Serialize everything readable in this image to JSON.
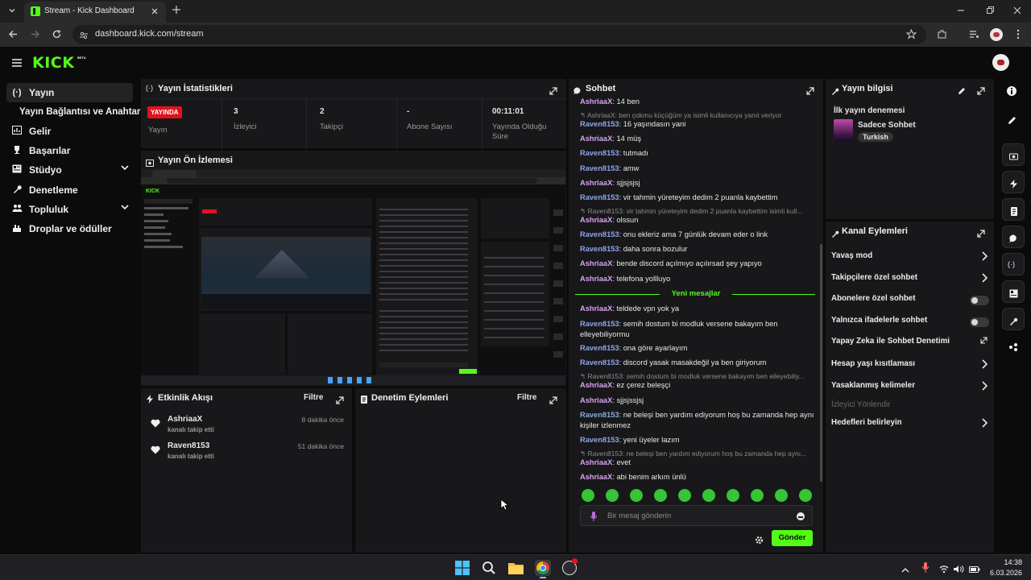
{
  "browser": {
    "tab_title": "Stream - Kick Dashboard",
    "url": "dashboard.kick.com/stream"
  },
  "header": {
    "logo": "KICK",
    "logo_badge": "BETA"
  },
  "sidebar": {
    "items": [
      {
        "label": "Yayın",
        "icon": "broadcast-icon"
      },
      {
        "label": "Yayın Bağlantısı ve Anahtarı"
      },
      {
        "label": "Gelir",
        "icon": "revenue-icon"
      },
      {
        "label": "Başarılar",
        "icon": "trophy-icon"
      },
      {
        "label": "Stüdyo",
        "icon": "studio-icon"
      },
      {
        "label": "Denetleme",
        "icon": "wrench-icon"
      },
      {
        "label": "Topluluk",
        "icon": "community-icon"
      },
      {
        "label": "Droplar ve ödüller",
        "icon": "drops-icon"
      }
    ]
  },
  "stats": {
    "title": "Yayın İstatistikleri",
    "live_badge": "YAYINDA",
    "live_label": "Yayın",
    "viewers_value": "3",
    "viewers_label": "İzleyici",
    "followers_value": "2",
    "followers_label": "Takipçi",
    "subs_value": "-",
    "subs_label": "Abone Sayısı",
    "uptime_value": "00:11:01",
    "uptime_label": "Yayında Olduğu Süre"
  },
  "preview": {
    "title": "Yayın Ön İzlemesi"
  },
  "activity": {
    "title": "Etkinlik Akışı",
    "filter": "Filtre",
    "items": [
      {
        "user": "AshriaaX",
        "time": "8 dakika önce",
        "action": "kanalı takip etti"
      },
      {
        "user": "Raven8153",
        "time": "51 dakika önce",
        "action": "kanalı takip etti"
      }
    ]
  },
  "moderation": {
    "title": "Denetim Eylemleri",
    "filter": "Filtre"
  },
  "chat": {
    "title": "Sohbet",
    "messages": [
      {
        "user": "AshriaaX",
        "text": "14 ben"
      },
      {
        "reply": "AshriaaX: ben çokmu küçüğüm ya isimli kullanıcıya yanıt veriyor"
      },
      {
        "user": "Raven8153",
        "text": "16 yaşındasın yani"
      },
      {
        "user": "AshriaaX",
        "text": "14 müş"
      },
      {
        "user": "Raven8153",
        "text": "tutmadı"
      },
      {
        "user": "Raven8153",
        "text": "amw"
      },
      {
        "user": "AshriaaX",
        "text": "sjjsjsjsj"
      },
      {
        "user": "Raven8153",
        "text": "vir tahmin yüreteyim dedim 2 puanla kaybettim"
      },
      {
        "reply": "Raven8153: vir tahmin yüreteyim dedim 2 puanla kaybettim isimli kull..."
      },
      {
        "user": "AshriaaX",
        "text": "olssun"
      },
      {
        "user": "Raven8153",
        "text": "onu ekleriz ama 7 günlük devam eder o link"
      },
      {
        "user": "Raven8153",
        "text": "daha sonra bozulur"
      },
      {
        "user": "AshriaaX",
        "text": "bende discord açılmıyo açılırsad şey yapıyo"
      },
      {
        "user": "AshriaaX",
        "text": "telefona yollluyo"
      },
      {
        "divider": "Yeni mesajlar"
      },
      {
        "user": "AshriaaX",
        "text": "teldede vpn yok ya"
      },
      {
        "user": "Raven8153",
        "text": "semih dostum bi modluk versene bakayım ben elleyebiliyormu"
      },
      {
        "user": "Raven8153",
        "text": "ona göre ayarlayım"
      },
      {
        "user": "Raven8153",
        "text": "discord yasak masakdeğil ya ben giriyorum"
      },
      {
        "reply": "Raven8153: semih dostum bi modluk versene bakayım ben elleyebiliy..."
      },
      {
        "user": "AshriaaX",
        "text": "ez çerez beleşçi"
      },
      {
        "user": "AshriaaX",
        "text": "sjjsjssjsj"
      },
      {
        "user": "Raven8153",
        "text": "ne beleşi ben yardım ediyorum hoş bu zamanda hep aynı kişiler izlenmez"
      },
      {
        "user": "Raven8153",
        "text": "yeni üyeler lazım"
      },
      {
        "reply": "Raven8153: ne beleşi ben yardım ediyorum hoş bu zamanda hep aynı..."
      },
      {
        "user": "AshriaaX",
        "text": "evet"
      },
      {
        "user": "AshriaaX",
        "text": "abi benim arkım ünlü"
      }
    ],
    "input_placeholder": "Bir mesaj gönderin",
    "send_label": "Gönder"
  },
  "stream_info": {
    "title": "Yayın bilgisi",
    "stream_title": "İlk yayın denemesi",
    "category": "Sadece Sohbet",
    "language": "Turkish"
  },
  "channel_actions": {
    "title": "Kanal Eylemleri",
    "items": [
      {
        "label": "Yavaş mod",
        "kind": "chevron"
      },
      {
        "label": "Takipçilere özel sohbet",
        "kind": "chevron"
      },
      {
        "label": "Abonelere özel sohbet",
        "kind": "toggle",
        "on": false
      },
      {
        "label": "Yalnızca ifadelerle sohbet",
        "kind": "toggle",
        "on": false
      },
      {
        "label": "Yapay Zeka ile Sohbet Denetimi",
        "kind": "external"
      },
      {
        "label": "Hesap yaşı kısıtlaması",
        "kind": "chevron"
      },
      {
        "label": "Yasaklanmış kelimeler",
        "kind": "chevron"
      },
      {
        "label": "İzleyici Yönlendir",
        "kind": "disabled"
      },
      {
        "label": "Hedefleri belirleyin",
        "kind": "chevron"
      }
    ]
  },
  "taskbar": {
    "time": "14:38",
    "date": "6.03.2026"
  },
  "colors": {
    "brand_green": "#53fc18",
    "live_red": "#e0131c",
    "user_a": "#d8a2ef",
    "user_r": "#8aa8e6"
  }
}
